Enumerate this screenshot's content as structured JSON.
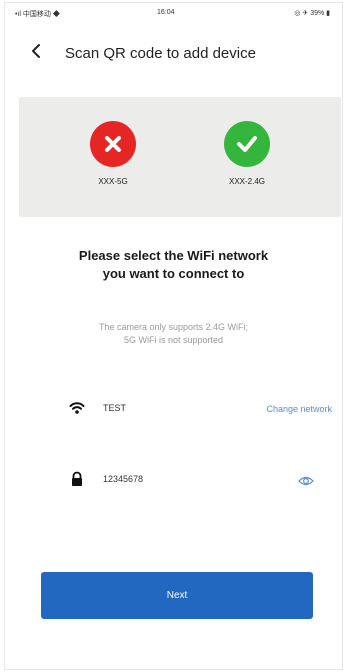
{
  "status_bar": {
    "carrier": "•ıl 中国移动 ◆",
    "time": "16:04",
    "right": "◎ ✈ 39% ▮"
  },
  "header": {
    "title": "Scan QR code to add device"
  },
  "examples": {
    "bad_label": "XXX-5G",
    "good_label": "XXX-2.4G"
  },
  "headline": {
    "line1": "Please select the WiFi network",
    "line2": "you want to connect to"
  },
  "note": {
    "line1": "The camera only supports 2.4G WiFi;",
    "line2": "5G WiFi is not supported"
  },
  "wifi": {
    "ssid": "TEST",
    "change_label": "Change network"
  },
  "password": {
    "value": "12345678"
  },
  "next_label": "Next",
  "colors": {
    "accent": "#2268c0",
    "link": "#5b8bd6",
    "error": "#e52625",
    "success": "#34b53c",
    "panel": "#ececea"
  },
  "icons": {
    "back": "back-arrow-icon",
    "wifi": "wifi-icon",
    "lock": "lock-icon",
    "eye": "eye-icon",
    "x": "x-circle-icon",
    "check": "check-circle-icon"
  }
}
